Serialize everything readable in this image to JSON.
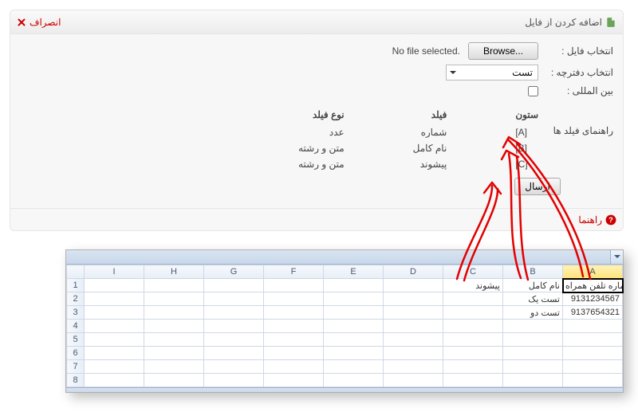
{
  "dialog": {
    "title": "اضافه کردن از فایل",
    "cancel": "انصراف",
    "file_label": "انتخاب فایل :",
    "browse": "Browse...",
    "no_file": "No file selected.",
    "book_label": "انتخاب دفترچه :",
    "book_value": "تست",
    "intl_label": "بین المللی :",
    "guide_label": "راهنمای فیلد ها",
    "colA": {
      "head": "ستون",
      "rows": [
        "[A]",
        "[B]",
        "[C]"
      ]
    },
    "colB": {
      "head": "فیلد",
      "rows": [
        "شماره",
        "نام کامل",
        "پیشوند"
      ]
    },
    "colC": {
      "head": "نوع فیلد",
      "rows": [
        "عدد",
        "متن و رشته",
        "متن و رشته"
      ]
    },
    "send": "ارسال",
    "help": "راهنما"
  },
  "sheet": {
    "headers": [
      "A",
      "B",
      "C",
      "D",
      "E",
      "F",
      "G",
      "H",
      "I"
    ],
    "rows": [
      {
        "n": "1",
        "cells": [
          "شماره تلفن همراه",
          "نام کامل",
          "پیشوند",
          "",
          "",
          "",
          "",
          "",
          ""
        ]
      },
      {
        "n": "2",
        "cells": [
          "9131234567",
          "تست یک",
          "",
          "",
          "",
          "",
          "",
          "",
          ""
        ]
      },
      {
        "n": "3",
        "cells": [
          "9137654321",
          "تست دو",
          "",
          "",
          "",
          "",
          "",
          "",
          ""
        ]
      },
      {
        "n": "4",
        "cells": [
          "",
          "",
          "",
          "",
          "",
          "",
          "",
          "",
          ""
        ]
      },
      {
        "n": "5",
        "cells": [
          "",
          "",
          "",
          "",
          "",
          "",
          "",
          "",
          ""
        ]
      },
      {
        "n": "6",
        "cells": [
          "",
          "",
          "",
          "",
          "",
          "",
          "",
          "",
          ""
        ]
      },
      {
        "n": "7",
        "cells": [
          "",
          "",
          "",
          "",
          "",
          "",
          "",
          "",
          ""
        ]
      },
      {
        "n": "8",
        "cells": [
          "",
          "",
          "",
          "",
          "",
          "",
          "",
          "",
          ""
        ]
      }
    ]
  }
}
